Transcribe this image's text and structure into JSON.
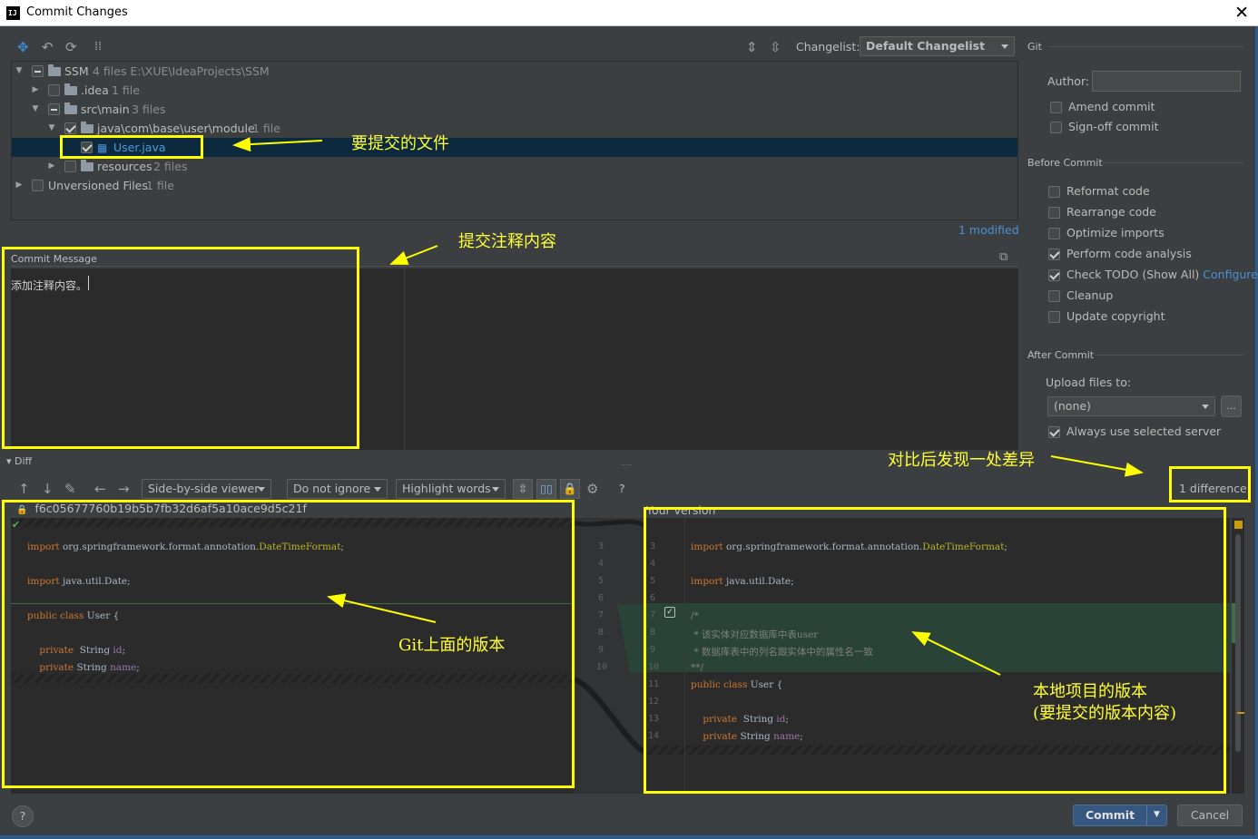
{
  "window": {
    "title": "Commit Changes"
  },
  "toolbar": {
    "changelist_label": "Changelist:",
    "changelist_value": "Default Changelist"
  },
  "tree": [
    {
      "name": "SSM",
      "meta": "4 files  E:\\XUE\\IdeaProjects\\SSM"
    },
    {
      "name": ".idea",
      "meta": "1 file"
    },
    {
      "name": "src\\main",
      "meta": "3 files"
    },
    {
      "name": "java\\com\\base\\user\\module",
      "meta": "1 file"
    },
    {
      "name": "User.java",
      "meta": ""
    },
    {
      "name": "resources",
      "meta": "2 files"
    },
    {
      "name": "Unversioned Files",
      "meta": "1 file"
    }
  ],
  "modified": "1 modified",
  "commit_message": {
    "label": "Commit Message",
    "text": "添加注释内容。"
  },
  "git": {
    "title": "Git",
    "author_label": "Author:",
    "amend": "Amend commit",
    "signoff": "Sign-off commit",
    "before_commit": "Before Commit",
    "options": [
      "Reformat code",
      "Rearrange code",
      "Optimize imports",
      "Perform code analysis",
      "Check TODO (Show All)",
      "Cleanup",
      "Update copyright"
    ],
    "configure": "Configure",
    "after_commit": "After Commit",
    "upload_label": "Upload files to:",
    "upload_value": "(none)",
    "browse": "...",
    "always": "Always use selected server"
  },
  "diff": {
    "title": "Diff",
    "viewer": "Side-by-side viewer",
    "ignore": "Do not ignore",
    "highlight": "Highlight words",
    "help": "?",
    "differences": "1 difference",
    "left_hash": "f6c05677760b19b5b7fb32d6af5a10ace9d5c21f",
    "right_title": "Your version",
    "left_lines": [
      "3",
      "4",
      "5",
      "6",
      "7",
      "8",
      "9",
      "10"
    ],
    "right_lines": [
      "3",
      "4",
      "5",
      "6",
      "7",
      "8",
      "9",
      "10",
      "11",
      "12",
      "13",
      "14"
    ],
    "code": {
      "import1": "org.springframework.format.annotation.",
      "import1_cls": "DateTimeFormat",
      "import2": "java.util.Date;",
      "class_decl": "User {",
      "field_type": "String",
      "id": "id",
      "name": "name",
      "c1": "/*",
      "c2": " * 该实体对应数据库中表user",
      "c3": " * 数据库表中的列名跟实体中的属性名一致",
      "c4": "**/"
    }
  },
  "annotations": {
    "files": "要提交的文件",
    "message": "提交注释内容",
    "diff": "对比后发现一处差异",
    "git_version": "Git上面的版本",
    "local1": "本地项目的版本",
    "local2": "(要提交的版本内容)"
  },
  "buttons": {
    "commit": "Commit",
    "cancel": "Cancel",
    "help": "?"
  }
}
